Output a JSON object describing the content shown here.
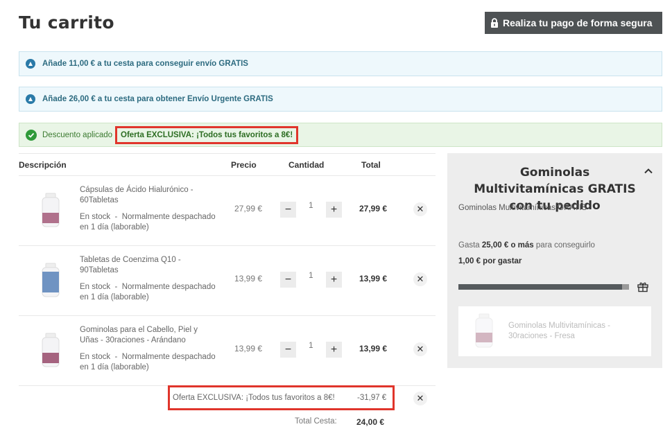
{
  "header": {
    "title": "Tu carrito",
    "secure_button": "Realiza tu pago de forma segura"
  },
  "banners": {
    "free_shipping": "Añade 11,00 € a tu cesta para conseguir envío GRATIS",
    "urgent_shipping": "Añade 26,00 € a tu cesta para obtener Envío Urgente GRATIS",
    "discount_prefix": "Descuento aplicado",
    "discount_name": "Oferta EXCLUSIVA: ¡Todos tus favoritos a 8€!"
  },
  "table": {
    "headers": {
      "description": "Descripción",
      "price": "Precio",
      "quantity": "Cantidad",
      "total": "Total"
    },
    "items": [
      {
        "name": "Cápsulas de Ácido Hialurónico - 60Tabletas",
        "stock": "En stock",
        "delivery": "Normalmente despachado en 1 día (laborable)",
        "price": "27,99 €",
        "quantity": "1",
        "total": "27,99 €",
        "thumb_color": "#b0718c"
      },
      {
        "name": "Tabletas de Coenzima Q10 - 90Tabletas",
        "stock": "En stock",
        "delivery": "Normalmente despachado en 1 día (laborable)",
        "price": "13,99 €",
        "quantity": "1",
        "total": "13,99 €",
        "thumb_color": "#6f93c2"
      },
      {
        "name": "Gominolas para el Cabello, Piel y Uñas - 30raciones - Arándano",
        "stock": "En stock",
        "delivery": "Normalmente despachado en 1 día (laborable)",
        "price": "13,99 €",
        "quantity": "1",
        "total": "13,99 €",
        "thumb_color": "#a5637f"
      }
    ],
    "minus": "−",
    "plus": "+",
    "remove": "✕"
  },
  "offer": {
    "label": "Oferta EXCLUSIVA: ¡Todos tus favoritos a 8€!",
    "amount": "-31,97 €"
  },
  "summary": {
    "total_label": "Total Cesta:",
    "total_value": "24,00 €"
  },
  "promo_panel": {
    "title": "Gominolas Multivitamínicas GRATIS con tu pedido",
    "subtitle": "Gominolas Multivitamínicas GRATIS",
    "spend_prefix": "Gasta",
    "spend_amount": "25,00 € o más",
    "spend_suffix": "para conseguirlo",
    "remaining": "1,00 € por gastar",
    "progress_fraction": 0.96,
    "product_name": "Gominolas Multivitamínicas - 30raciones - Fresa"
  },
  "colors": {
    "secure_button_bg": "#4e5254",
    "info_banner_bg": "#eef8fc",
    "success_banner_bg": "#e9f5e6",
    "highlight_border": "#e0352b"
  }
}
